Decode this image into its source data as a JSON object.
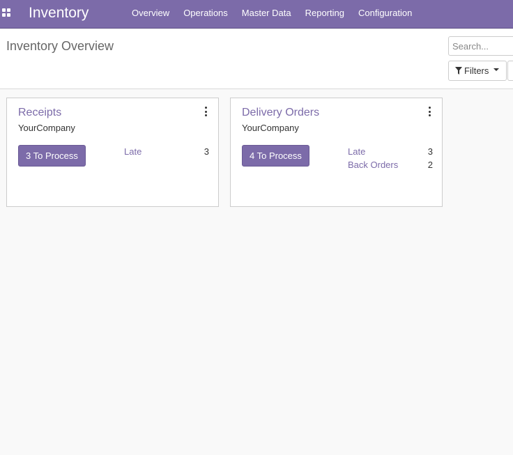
{
  "navbar": {
    "brand": "Inventory",
    "menu": [
      "Overview",
      "Operations",
      "Master Data",
      "Reporting",
      "Configuration"
    ]
  },
  "control_panel": {
    "title": "Inventory Overview",
    "search_placeholder": "Search...",
    "filters_label": "Filters"
  },
  "cards": [
    {
      "title": "Receipts",
      "company": "YourCompany",
      "process_label": "3 To Process",
      "stats": [
        {
          "label": "Late",
          "value": "3"
        }
      ]
    },
    {
      "title": "Delivery Orders",
      "company": "YourCompany",
      "process_label": "4 To Process",
      "stats": [
        {
          "label": "Late",
          "value": "3"
        },
        {
          "label": "Back Orders",
          "value": "2"
        }
      ]
    }
  ],
  "colors": {
    "brand": "#7c6ba9",
    "background": "#f9f9f9"
  }
}
